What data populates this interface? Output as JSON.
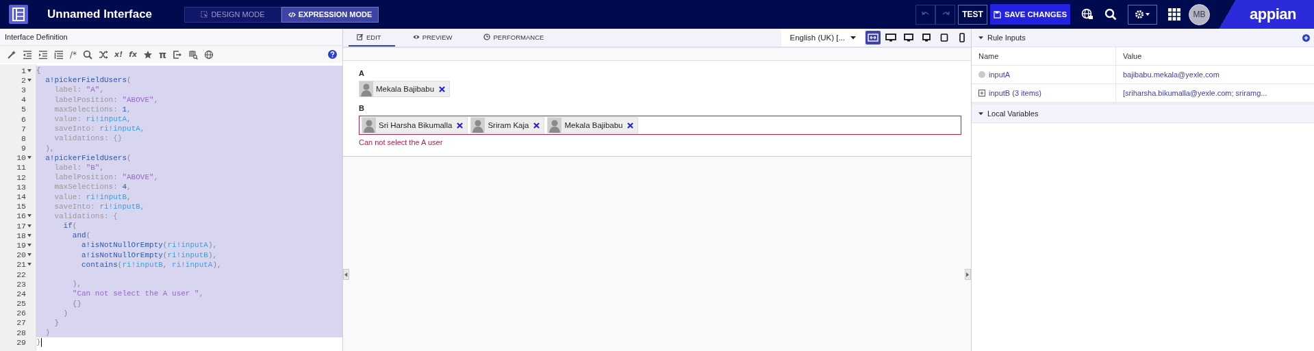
{
  "app_bar": {
    "title": "Unnamed Interface",
    "modes": [
      {
        "label": "DESIGN MODE",
        "selected": false
      },
      {
        "label": "EXPRESSION MODE",
        "selected": true
      }
    ],
    "test_button": "TEST",
    "save_button": "SAVE CHANGES",
    "avatar": "MB",
    "logo": "appian"
  },
  "editor": {
    "title": "Interface Definition",
    "toolbar_glyphs": [
      "/*",
      "x!",
      "fx",
      "π"
    ],
    "lines": [
      {
        "number": "1",
        "foldable": true,
        "selected": true,
        "tokens": [
          {
            "kind": "punct",
            "text": "{"
          }
        ]
      },
      {
        "number": "2",
        "foldable": true,
        "selected": true,
        "tokens": [
          {
            "kind": "fn",
            "text": "  a!pickerFieldUsers"
          },
          {
            "kind": "punct",
            "text": "("
          }
        ]
      },
      {
        "number": "3",
        "foldable": false,
        "selected": true,
        "tokens": [
          {
            "kind": "key",
            "text": "    label: "
          },
          {
            "kind": "str",
            "text": "\"A\""
          },
          {
            "kind": "punct",
            "text": ","
          }
        ]
      },
      {
        "number": "4",
        "foldable": false,
        "selected": true,
        "tokens": [
          {
            "kind": "key",
            "text": "    labelPosition: "
          },
          {
            "kind": "str",
            "text": "\"ABOVE\""
          },
          {
            "kind": "punct",
            "text": ","
          }
        ]
      },
      {
        "number": "5",
        "foldable": false,
        "selected": true,
        "tokens": [
          {
            "kind": "key",
            "text": "    maxSelections: "
          },
          {
            "kind": "num",
            "text": "1"
          },
          {
            "kind": "punct",
            "text": ","
          }
        ]
      },
      {
        "number": "6",
        "foldable": false,
        "selected": true,
        "tokens": [
          {
            "kind": "key",
            "text": "    value: "
          },
          {
            "kind": "ref",
            "text": "ri!inputA"
          },
          {
            "kind": "punct",
            "text": ","
          }
        ]
      },
      {
        "number": "7",
        "foldable": false,
        "selected": true,
        "tokens": [
          {
            "kind": "key",
            "text": "    saveInto: "
          },
          {
            "kind": "ref",
            "text": "ri!inputA"
          },
          {
            "kind": "punct",
            "text": ","
          }
        ]
      },
      {
        "number": "8",
        "foldable": false,
        "selected": true,
        "tokens": [
          {
            "kind": "key",
            "text": "    validations: {}"
          }
        ]
      },
      {
        "number": "9",
        "foldable": false,
        "selected": true,
        "tokens": [
          {
            "kind": "punct",
            "text": "  ),"
          }
        ]
      },
      {
        "number": "10",
        "foldable": true,
        "selected": true,
        "tokens": [
          {
            "kind": "fn",
            "text": "  a!pickerFieldUsers"
          },
          {
            "kind": "punct",
            "text": "("
          }
        ]
      },
      {
        "number": "11",
        "foldable": false,
        "selected": true,
        "tokens": [
          {
            "kind": "key",
            "text": "    label: "
          },
          {
            "kind": "str",
            "text": "\"B\""
          },
          {
            "kind": "punct",
            "text": ","
          }
        ]
      },
      {
        "number": "12",
        "foldable": false,
        "selected": true,
        "tokens": [
          {
            "kind": "key",
            "text": "    labelPosition: "
          },
          {
            "kind": "str",
            "text": "\"ABOVE\""
          },
          {
            "kind": "punct",
            "text": ","
          }
        ]
      },
      {
        "number": "13",
        "foldable": false,
        "selected": true,
        "tokens": [
          {
            "kind": "key",
            "text": "    maxSelections: "
          },
          {
            "kind": "num",
            "text": "4"
          },
          {
            "kind": "punct",
            "text": ","
          }
        ]
      },
      {
        "number": "14",
        "foldable": false,
        "selected": true,
        "tokens": [
          {
            "kind": "key",
            "text": "    value: "
          },
          {
            "kind": "ref",
            "text": "ri!inputB"
          },
          {
            "kind": "punct",
            "text": ","
          }
        ]
      },
      {
        "number": "15",
        "foldable": false,
        "selected": true,
        "tokens": [
          {
            "kind": "key",
            "text": "    saveInto: "
          },
          {
            "kind": "ref",
            "text": "ri!inputB"
          },
          {
            "kind": "punct",
            "text": ","
          }
        ]
      },
      {
        "number": "16",
        "foldable": true,
        "selected": true,
        "tokens": [
          {
            "kind": "key",
            "text": "    validations: {"
          }
        ]
      },
      {
        "number": "17",
        "foldable": true,
        "selected": true,
        "tokens": [
          {
            "kind": "fn",
            "text": "      if"
          },
          {
            "kind": "punct",
            "text": "("
          }
        ]
      },
      {
        "number": "18",
        "foldable": true,
        "selected": true,
        "tokens": [
          {
            "kind": "fn",
            "text": "        and"
          },
          {
            "kind": "punct",
            "text": "("
          }
        ]
      },
      {
        "number": "19",
        "foldable": true,
        "selected": true,
        "tokens": [
          {
            "kind": "fn",
            "text": "          a!isNotNullOrEmpty"
          },
          {
            "kind": "punct",
            "text": "("
          },
          {
            "kind": "ref",
            "text": "ri!inputA"
          },
          {
            "kind": "punct",
            "text": "),"
          }
        ]
      },
      {
        "number": "20",
        "foldable": true,
        "selected": true,
        "tokens": [
          {
            "kind": "fn",
            "text": "          a!isNotNullOrEmpty"
          },
          {
            "kind": "punct",
            "text": "("
          },
          {
            "kind": "ref",
            "text": "ri!inputB"
          },
          {
            "kind": "punct",
            "text": "),"
          }
        ]
      },
      {
        "number": "21",
        "foldable": true,
        "selected": true,
        "tokens": [
          {
            "kind": "fn",
            "text": "          contains"
          },
          {
            "kind": "punct",
            "text": "("
          },
          {
            "kind": "ref",
            "text": "ri!inputB"
          },
          {
            "kind": "punct",
            "text": ", "
          },
          {
            "kind": "ref",
            "text": "ri!inputA"
          },
          {
            "kind": "punct",
            "text": "),"
          }
        ]
      },
      {
        "number": "22",
        "foldable": false,
        "selected": true
      },
      {
        "number": "23",
        "foldable": false,
        "selected": true,
        "tokens": [
          {
            "kind": "punct",
            "text": "        ),"
          }
        ]
      },
      {
        "number": "24",
        "foldable": false,
        "selected": true,
        "tokens": [
          {
            "kind": "str",
            "text": "        \"Can not select the A user \""
          },
          {
            "kind": "punct",
            "text": ","
          }
        ]
      },
      {
        "number": "25",
        "foldable": false,
        "selected": true,
        "tokens": [
          {
            "kind": "punct",
            "text": "        {}"
          }
        ]
      },
      {
        "number": "26",
        "foldable": false,
        "selected": true,
        "tokens": [
          {
            "kind": "punct",
            "text": "      )"
          }
        ]
      },
      {
        "number": "27",
        "foldable": false,
        "selected": true,
        "tokens": [
          {
            "kind": "punct",
            "text": "    }"
          }
        ]
      },
      {
        "number": "28",
        "foldable": false,
        "selected": true,
        "tokens": [
          {
            "kind": "punct",
            "text": "  )"
          }
        ]
      },
      {
        "number": "29",
        "foldable": false,
        "selected": false,
        "tokens": [
          {
            "kind": "punct",
            "text": "}"
          }
        ]
      }
    ]
  },
  "preview": {
    "tabs": [
      {
        "label": "EDIT",
        "selected": true
      },
      {
        "label": "PREVIEW",
        "selected": false
      },
      {
        "label": "PERFORMANCE",
        "selected": false
      }
    ],
    "locale": "English (UK) [...",
    "devices": [
      {
        "selected": true
      },
      {
        "selected": false
      },
      {
        "selected": false
      },
      {
        "selected": false
      },
      {
        "selected": false
      },
      {
        "selected": false
      }
    ],
    "fields": [
      {
        "label": "A",
        "error": false,
        "chips": [
          "Mekala Bajibabu"
        ]
      },
      {
        "label": "B",
        "error": true,
        "chips": [
          "Sri Harsha Bikumalla",
          "Sriram Kaja",
          "Mekala Bajibabu"
        ],
        "message": "Can not select the A user"
      }
    ]
  },
  "rule_inputs": {
    "title": "Rule Inputs",
    "columns": [
      "Name",
      "Value"
    ],
    "rows": [
      {
        "kind": "single",
        "name": "inputA",
        "value": "bajibabu.mekala@yexle.com"
      },
      {
        "kind": "list",
        "name": "inputB (3 items)",
        "value": "[sriharsha.bikumalla@yexle.com; sriramg..."
      }
    ]
  },
  "local_variables": {
    "title": "Local Variables"
  }
}
